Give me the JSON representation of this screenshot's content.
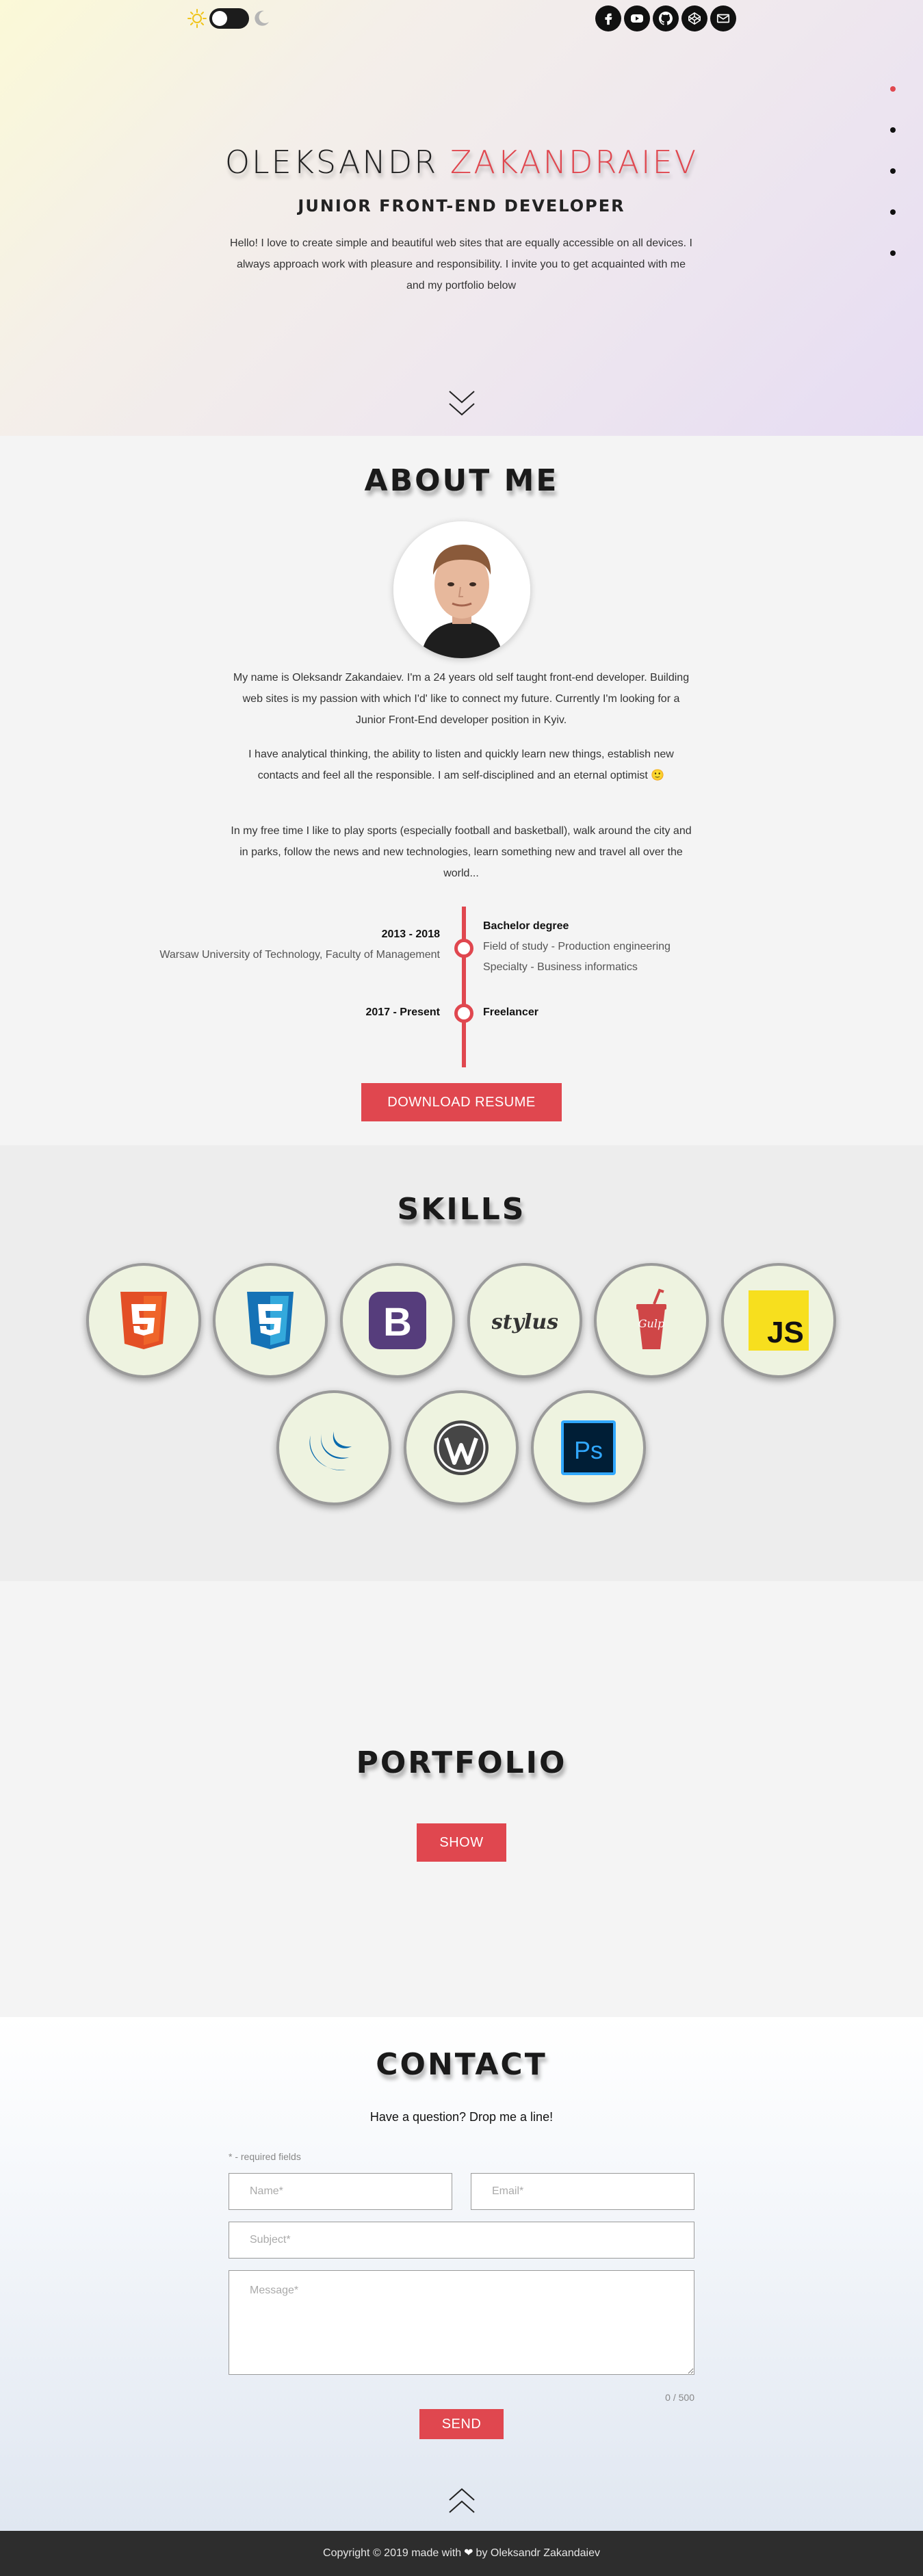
{
  "hero": {
    "first_name": "OLEKSANDR",
    "last_name": "ZAKANDRAIEV",
    "role": "JUNIOR FRONT-END DEVELOPER",
    "intro": "Hello! I love to create simple and beautiful web sites that are equally accessible on all devices. I always approach work with pleasure and responsibility. I invite you to get acquainted with me and my portfolio below"
  },
  "header": {
    "theme_icons": [
      "sun-icon",
      "toggle-switch",
      "moon-icon"
    ],
    "socials": [
      "facebook-icon",
      "youtube-icon",
      "github-icon",
      "codepen-icon",
      "email-icon"
    ]
  },
  "nav_dots": {
    "count": 5,
    "active_index": 0
  },
  "about": {
    "title": "ABOUT ME",
    "p1": "My name is Oleksandr Zakandaiev. I'm a 24 years old self taught front-end developer. Building web sites is my passion with which I'd' like to connect my future. Currently I'm looking for a Junior Front-End developer position in Kyiv.",
    "p2": "I have analytical thinking, the ability to listen and quickly learn new things, establish new contacts and feel all the responsible. I am self-disciplined and an eternal optimist 🙂",
    "p3": "In my free time I like to play sports (especially football and basketball), walk around the city and in parks, follow the news and new technologies, learn something new and travel all over the world...",
    "timeline": [
      {
        "date": "2013 - 2018",
        "org": "Warsaw University of Technology, Faculty of Management",
        "title": "Bachelor degree",
        "detail1": "Field of study - Production engineering",
        "detail2": "Specialty - Business informatics"
      },
      {
        "date": "2017 - Present",
        "title": "Freelancer"
      }
    ],
    "resume_button": "DOWNLOAD RESUME"
  },
  "skills": {
    "title": "SKILLS",
    "items": [
      "html5-icon",
      "css3-icon",
      "bootstrap-icon",
      "stylus-icon",
      "gulp-icon",
      "javascript-icon",
      "jquery-icon",
      "wordpress-icon",
      "photoshop-icon"
    ],
    "labels": {
      "bootstrap": "B",
      "stylus": "stylus",
      "gulp": "Gulp",
      "js": "JS",
      "ps": "Ps"
    }
  },
  "portfolio": {
    "title": "PORTFOLIO",
    "show_button": "SHOW"
  },
  "contact": {
    "title": "CONTACT",
    "subtitle": "Have a question? Drop me a line!",
    "required_note": "* - required fields",
    "name_placeholder": "Name*",
    "email_placeholder": "Email*",
    "subject_placeholder": "Subject*",
    "message_placeholder": "Message*",
    "counter": "0 / 500",
    "send_button": "SEND"
  },
  "footer": {
    "before": "Copyright © 2019 made with",
    "after": "by Oleksandr Zakandaiev"
  },
  "colors": {
    "accent": "#e0474f",
    "dark": "#1c1c1c",
    "footer_bg": "#2d2d2d",
    "skill_bg": "#eef3e0"
  }
}
